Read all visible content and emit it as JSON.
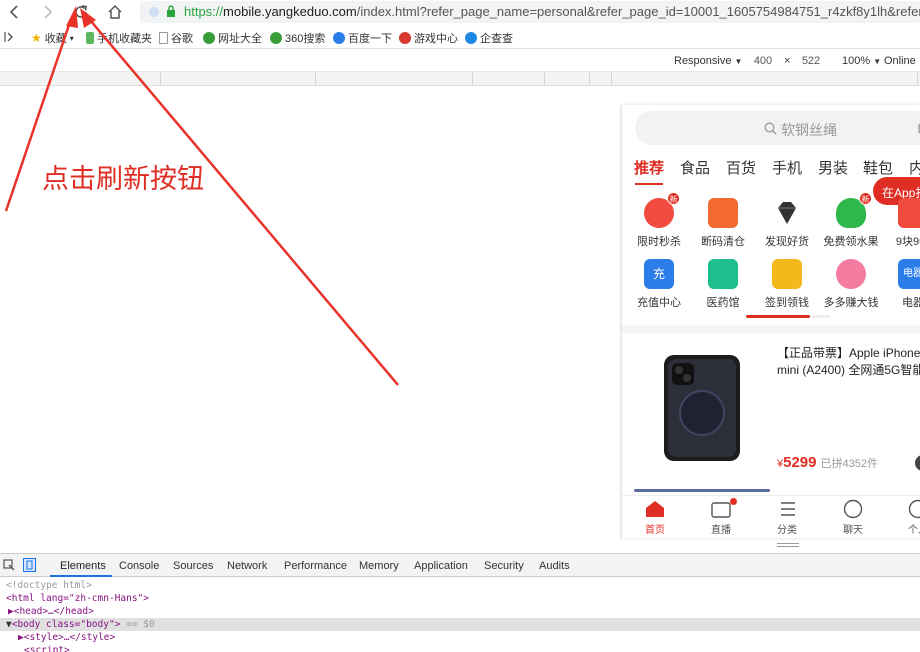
{
  "browser": {
    "url_protocol": "https://",
    "url_host": "mobile.yangkeduo.com",
    "url_path": "/index.html?refer_page_name=personal&refer_page_id=10001_1605754984751_r4zkf8y1lh&refer_page",
    "icons": [
      "back-icon",
      "forward-icon",
      "reload-icon",
      "home-icon",
      "shield-icon",
      "lock-icon"
    ]
  },
  "bookmarks": {
    "items": [
      "收藏",
      "手机收藏夹",
      "谷歌",
      "网址大全",
      "360搜索",
      "百度一下",
      "游戏中心",
      "企查查"
    ]
  },
  "device_toolbar": {
    "mode": "Responsive",
    "width": "400",
    "times": "×",
    "height": "522",
    "zoom": "100%",
    "network": "Online"
  },
  "annotation": {
    "text": "点击刷新按钮",
    "color": "#e02e24"
  },
  "mobile": {
    "search_placeholder": "软钢丝绳",
    "tabs": [
      "推荐",
      "食品",
      "百货",
      "手机",
      "男装",
      "鞋包",
      "内"
    ],
    "app_button": "在App打",
    "categories_row1": [
      {
        "label": "限时秒杀",
        "icon": "flash-sale-icon",
        "badge": "新"
      },
      {
        "label": "断码清仓",
        "icon": "clearance-icon"
      },
      {
        "label": "发现好货",
        "icon": "diamond-icon"
      },
      {
        "label": "免费领水果",
        "icon": "tree-icon",
        "badge": "新"
      },
      {
        "label": "9块9特",
        "icon": "nine-nine-icon"
      }
    ],
    "categories_row2": [
      {
        "label": "充值中心",
        "icon": "recharge-icon",
        "icon_text": "充"
      },
      {
        "label": "医药馆",
        "icon": "medicine-icon"
      },
      {
        "label": "签到领钱",
        "icon": "checkin-icon"
      },
      {
        "label": "多多赚大钱",
        "icon": "piggy-bank-icon"
      },
      {
        "label": "电器",
        "icon": "appliance-icon",
        "icon_text": "电器"
      }
    ],
    "product": {
      "title": "【正品带票】Apple iPhone 12 mini (A2400) 全网通5G智能",
      "currency": "¥",
      "price": "5299",
      "sold": "已拼4352件"
    },
    "bottom_nav": [
      {
        "label": "首页",
        "icon": "home-icon",
        "active": true
      },
      {
        "label": "直播",
        "icon": "live-tv-icon"
      },
      {
        "label": "分类",
        "icon": "category-list-icon"
      },
      {
        "label": "聊天",
        "icon": "chat-icon"
      },
      {
        "label": "个人",
        "icon": "person-icon"
      }
    ]
  },
  "devtools": {
    "tabs": [
      "Elements",
      "Console",
      "Sources",
      "Network",
      "Performance",
      "Memory",
      "Application",
      "Security",
      "Audits"
    ],
    "active_tab": "Elements",
    "dom": {
      "doctype": "<!doctype html>",
      "html_open": "<html lang=\"zh-cmn-Hans\">",
      "head": "<head>…</head>",
      "body_tag": "<body class=\"body\">",
      "body_marker": "== $0",
      "style": "<style>…</style>",
      "script": "<script>"
    }
  },
  "colors": {
    "accent": "#e02e24",
    "devtools_active": "#1a73e8"
  }
}
